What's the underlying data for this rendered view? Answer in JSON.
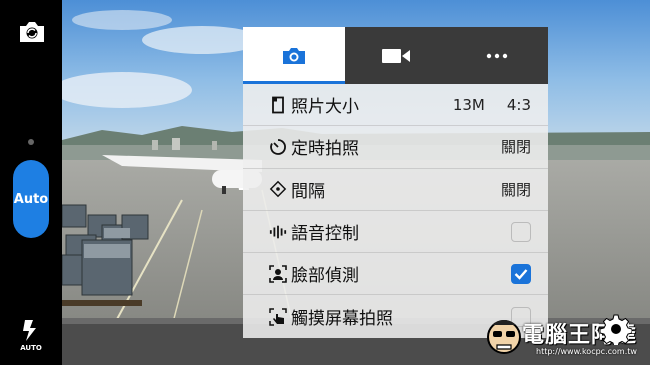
{
  "left_bar": {
    "mode_label": "Auto",
    "flash_label": "AUTO"
  },
  "panel": {
    "tabs": [
      {
        "icon": "camera-icon",
        "active": true
      },
      {
        "icon": "video-camera-icon",
        "active": false
      },
      {
        "icon": "more-icon",
        "active": false
      }
    ],
    "rows": [
      {
        "icon": "photo-size-icon",
        "label": "照片大小",
        "value": "13M",
        "value2": "4:3"
      },
      {
        "icon": "timer-icon",
        "label": "定時拍照",
        "value": "關閉"
      },
      {
        "icon": "interval-icon",
        "label": "間隔",
        "value": "關閉"
      },
      {
        "icon": "voice-control-icon",
        "label": "語音控制",
        "checked": false
      },
      {
        "icon": "face-detection-icon",
        "label": "臉部偵測",
        "checked": true
      },
      {
        "icon": "touch-shutter-icon",
        "label": "觸摸屏幕拍照",
        "checked": false
      }
    ]
  },
  "watermark": {
    "title": "電腦王阿達",
    "url": "http://www.kocpc.com.tw"
  },
  "colors": {
    "accent": "#1a73d9",
    "auto_button": "#1e7fe3",
    "tab_bar": "#3a3a3a"
  }
}
